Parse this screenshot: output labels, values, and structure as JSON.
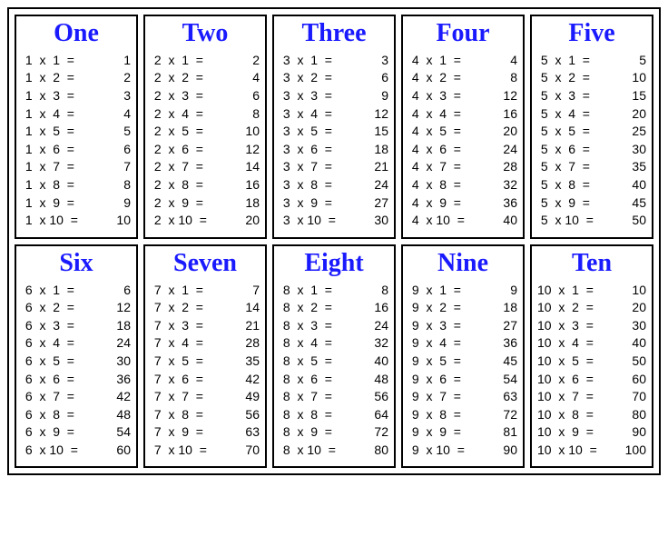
{
  "tables": [
    {
      "title": "One",
      "base": 1,
      "rows": [
        [
          1,
          1,
          1
        ],
        [
          1,
          2,
          2
        ],
        [
          1,
          3,
          3
        ],
        [
          1,
          4,
          4
        ],
        [
          1,
          5,
          5
        ],
        [
          1,
          6,
          6
        ],
        [
          1,
          7,
          7
        ],
        [
          1,
          8,
          8
        ],
        [
          1,
          9,
          9
        ],
        [
          1,
          10,
          10
        ]
      ]
    },
    {
      "title": "Two",
      "base": 2,
      "rows": [
        [
          2,
          1,
          2
        ],
        [
          2,
          2,
          4
        ],
        [
          2,
          3,
          6
        ],
        [
          2,
          4,
          8
        ],
        [
          2,
          5,
          10
        ],
        [
          2,
          6,
          12
        ],
        [
          2,
          7,
          14
        ],
        [
          2,
          8,
          16
        ],
        [
          2,
          9,
          18
        ],
        [
          2,
          10,
          20
        ]
      ]
    },
    {
      "title": "Three",
      "base": 3,
      "rows": [
        [
          3,
          1,
          3
        ],
        [
          3,
          2,
          6
        ],
        [
          3,
          3,
          9
        ],
        [
          3,
          4,
          12
        ],
        [
          3,
          5,
          15
        ],
        [
          3,
          6,
          18
        ],
        [
          3,
          7,
          21
        ],
        [
          3,
          8,
          24
        ],
        [
          3,
          9,
          27
        ],
        [
          3,
          10,
          30
        ]
      ]
    },
    {
      "title": "Four",
      "base": 4,
      "rows": [
        [
          4,
          1,
          4
        ],
        [
          4,
          2,
          8
        ],
        [
          4,
          3,
          12
        ],
        [
          4,
          4,
          16
        ],
        [
          4,
          5,
          20
        ],
        [
          4,
          6,
          24
        ],
        [
          4,
          7,
          28
        ],
        [
          4,
          8,
          32
        ],
        [
          4,
          9,
          36
        ],
        [
          4,
          10,
          40
        ]
      ]
    },
    {
      "title": "Five",
      "base": 5,
      "rows": [
        [
          5,
          1,
          5
        ],
        [
          5,
          2,
          10
        ],
        [
          5,
          3,
          15
        ],
        [
          5,
          4,
          20
        ],
        [
          5,
          5,
          25
        ],
        [
          5,
          6,
          30
        ],
        [
          5,
          7,
          35
        ],
        [
          5,
          8,
          40
        ],
        [
          5,
          9,
          45
        ],
        [
          5,
          10,
          50
        ]
      ]
    },
    {
      "title": "Six",
      "base": 6,
      "rows": [
        [
          6,
          1,
          6
        ],
        [
          6,
          2,
          12
        ],
        [
          6,
          3,
          18
        ],
        [
          6,
          4,
          24
        ],
        [
          6,
          5,
          30
        ],
        [
          6,
          6,
          36
        ],
        [
          6,
          7,
          42
        ],
        [
          6,
          8,
          48
        ],
        [
          6,
          9,
          54
        ],
        [
          6,
          10,
          60
        ]
      ]
    },
    {
      "title": "Seven",
      "base": 7,
      "rows": [
        [
          7,
          1,
          7
        ],
        [
          7,
          2,
          14
        ],
        [
          7,
          3,
          21
        ],
        [
          7,
          4,
          28
        ],
        [
          7,
          5,
          35
        ],
        [
          7,
          6,
          42
        ],
        [
          7,
          7,
          49
        ],
        [
          7,
          8,
          56
        ],
        [
          7,
          9,
          63
        ],
        [
          7,
          10,
          70
        ]
      ]
    },
    {
      "title": "Eight",
      "base": 8,
      "rows": [
        [
          8,
          1,
          8
        ],
        [
          8,
          2,
          16
        ],
        [
          8,
          3,
          24
        ],
        [
          8,
          4,
          32
        ],
        [
          8,
          5,
          40
        ],
        [
          8,
          6,
          48
        ],
        [
          8,
          7,
          56
        ],
        [
          8,
          8,
          64
        ],
        [
          8,
          9,
          72
        ],
        [
          8,
          10,
          80
        ]
      ]
    },
    {
      "title": "Nine",
      "base": 9,
      "rows": [
        [
          9,
          1,
          9
        ],
        [
          9,
          2,
          18
        ],
        [
          9,
          3,
          27
        ],
        [
          9,
          4,
          36
        ],
        [
          9,
          5,
          45
        ],
        [
          9,
          6,
          54
        ],
        [
          9,
          7,
          63
        ],
        [
          9,
          8,
          72
        ],
        [
          9,
          9,
          81
        ],
        [
          9,
          10,
          90
        ]
      ]
    },
    {
      "title": "Ten",
      "base": 10,
      "rows": [
        [
          10,
          1,
          10
        ],
        [
          10,
          2,
          20
        ],
        [
          10,
          3,
          30
        ],
        [
          10,
          4,
          40
        ],
        [
          10,
          5,
          50
        ],
        [
          10,
          6,
          60
        ],
        [
          10,
          7,
          70
        ],
        [
          10,
          8,
          80
        ],
        [
          10,
          9,
          90
        ],
        [
          10,
          10,
          100
        ]
      ]
    }
  ],
  "symbols": {
    "times": "x",
    "equals": "="
  }
}
